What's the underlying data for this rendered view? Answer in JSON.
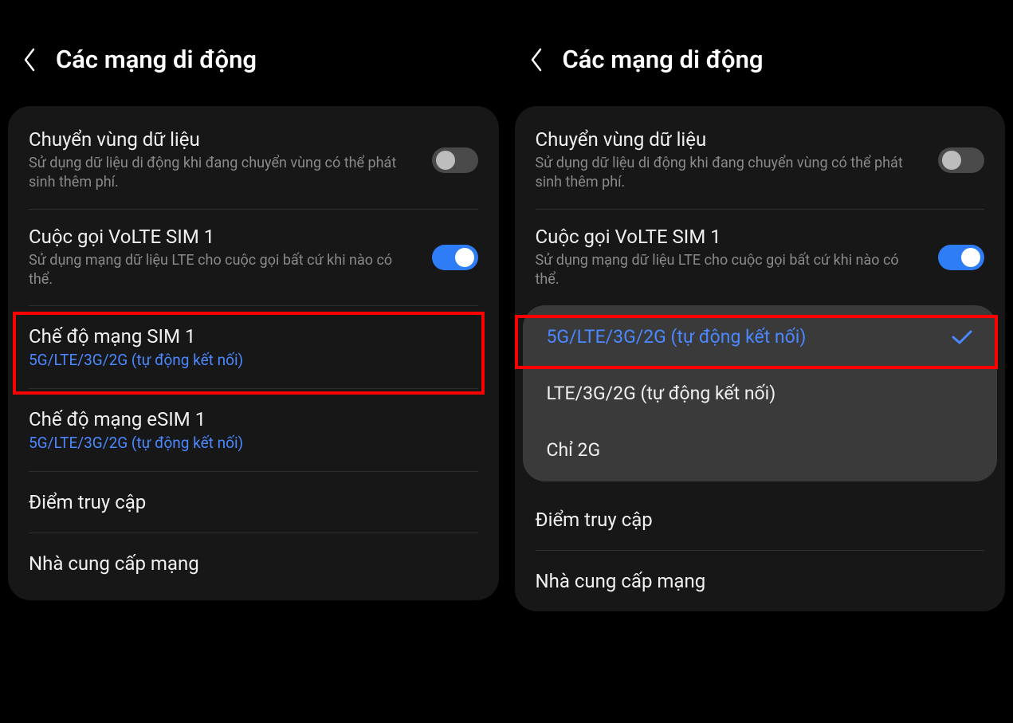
{
  "left": {
    "header": {
      "title": "Các mạng di động"
    },
    "roaming": {
      "title": "Chuyển vùng dữ liệu",
      "desc": "Sử dụng dữ liệu di động khi đang chuyển vùng có thể phát sinh thêm phí.",
      "toggle": false
    },
    "volte": {
      "title": "Cuộc gọi VoLTE SIM 1",
      "desc": "Sử dụng mạng dữ liệu LTE cho cuộc gọi bất cứ khi nào có thể.",
      "toggle": true
    },
    "netmode_sim1": {
      "title": "Chế độ mạng SIM 1",
      "value": "5G/LTE/3G/2G (tự động kết nối)"
    },
    "netmode_esim1": {
      "title": "Chế độ mạng eSIM 1",
      "value": "5G/LTE/3G/2G (tự động kết nối)"
    },
    "apn": {
      "title": "Điểm truy cập"
    },
    "carrier": {
      "title": "Nhà cung cấp mạng"
    }
  },
  "right": {
    "header": {
      "title": "Các mạng di động"
    },
    "roaming": {
      "title": "Chuyển vùng dữ liệu",
      "desc": "Sử dụng dữ liệu di động khi đang chuyển vùng có thể phát sinh thêm phí.",
      "toggle": false
    },
    "volte": {
      "title": "Cuộc gọi VoLTE SIM 1",
      "desc": "Sử dụng mạng dữ liệu LTE cho cuộc gọi bất cứ khi nào có thể.",
      "toggle": true
    },
    "dropdown": {
      "options": [
        {
          "label": "5G/LTE/3G/2G (tự động kết nối)",
          "selected": true
        },
        {
          "label": "LTE/3G/2G (tự động kết nối)",
          "selected": false
        },
        {
          "label": "Chỉ 2G",
          "selected": false
        }
      ]
    },
    "apn": {
      "title": "Điểm truy cập"
    },
    "carrier": {
      "title": "Nhà cung cấp mạng"
    }
  }
}
